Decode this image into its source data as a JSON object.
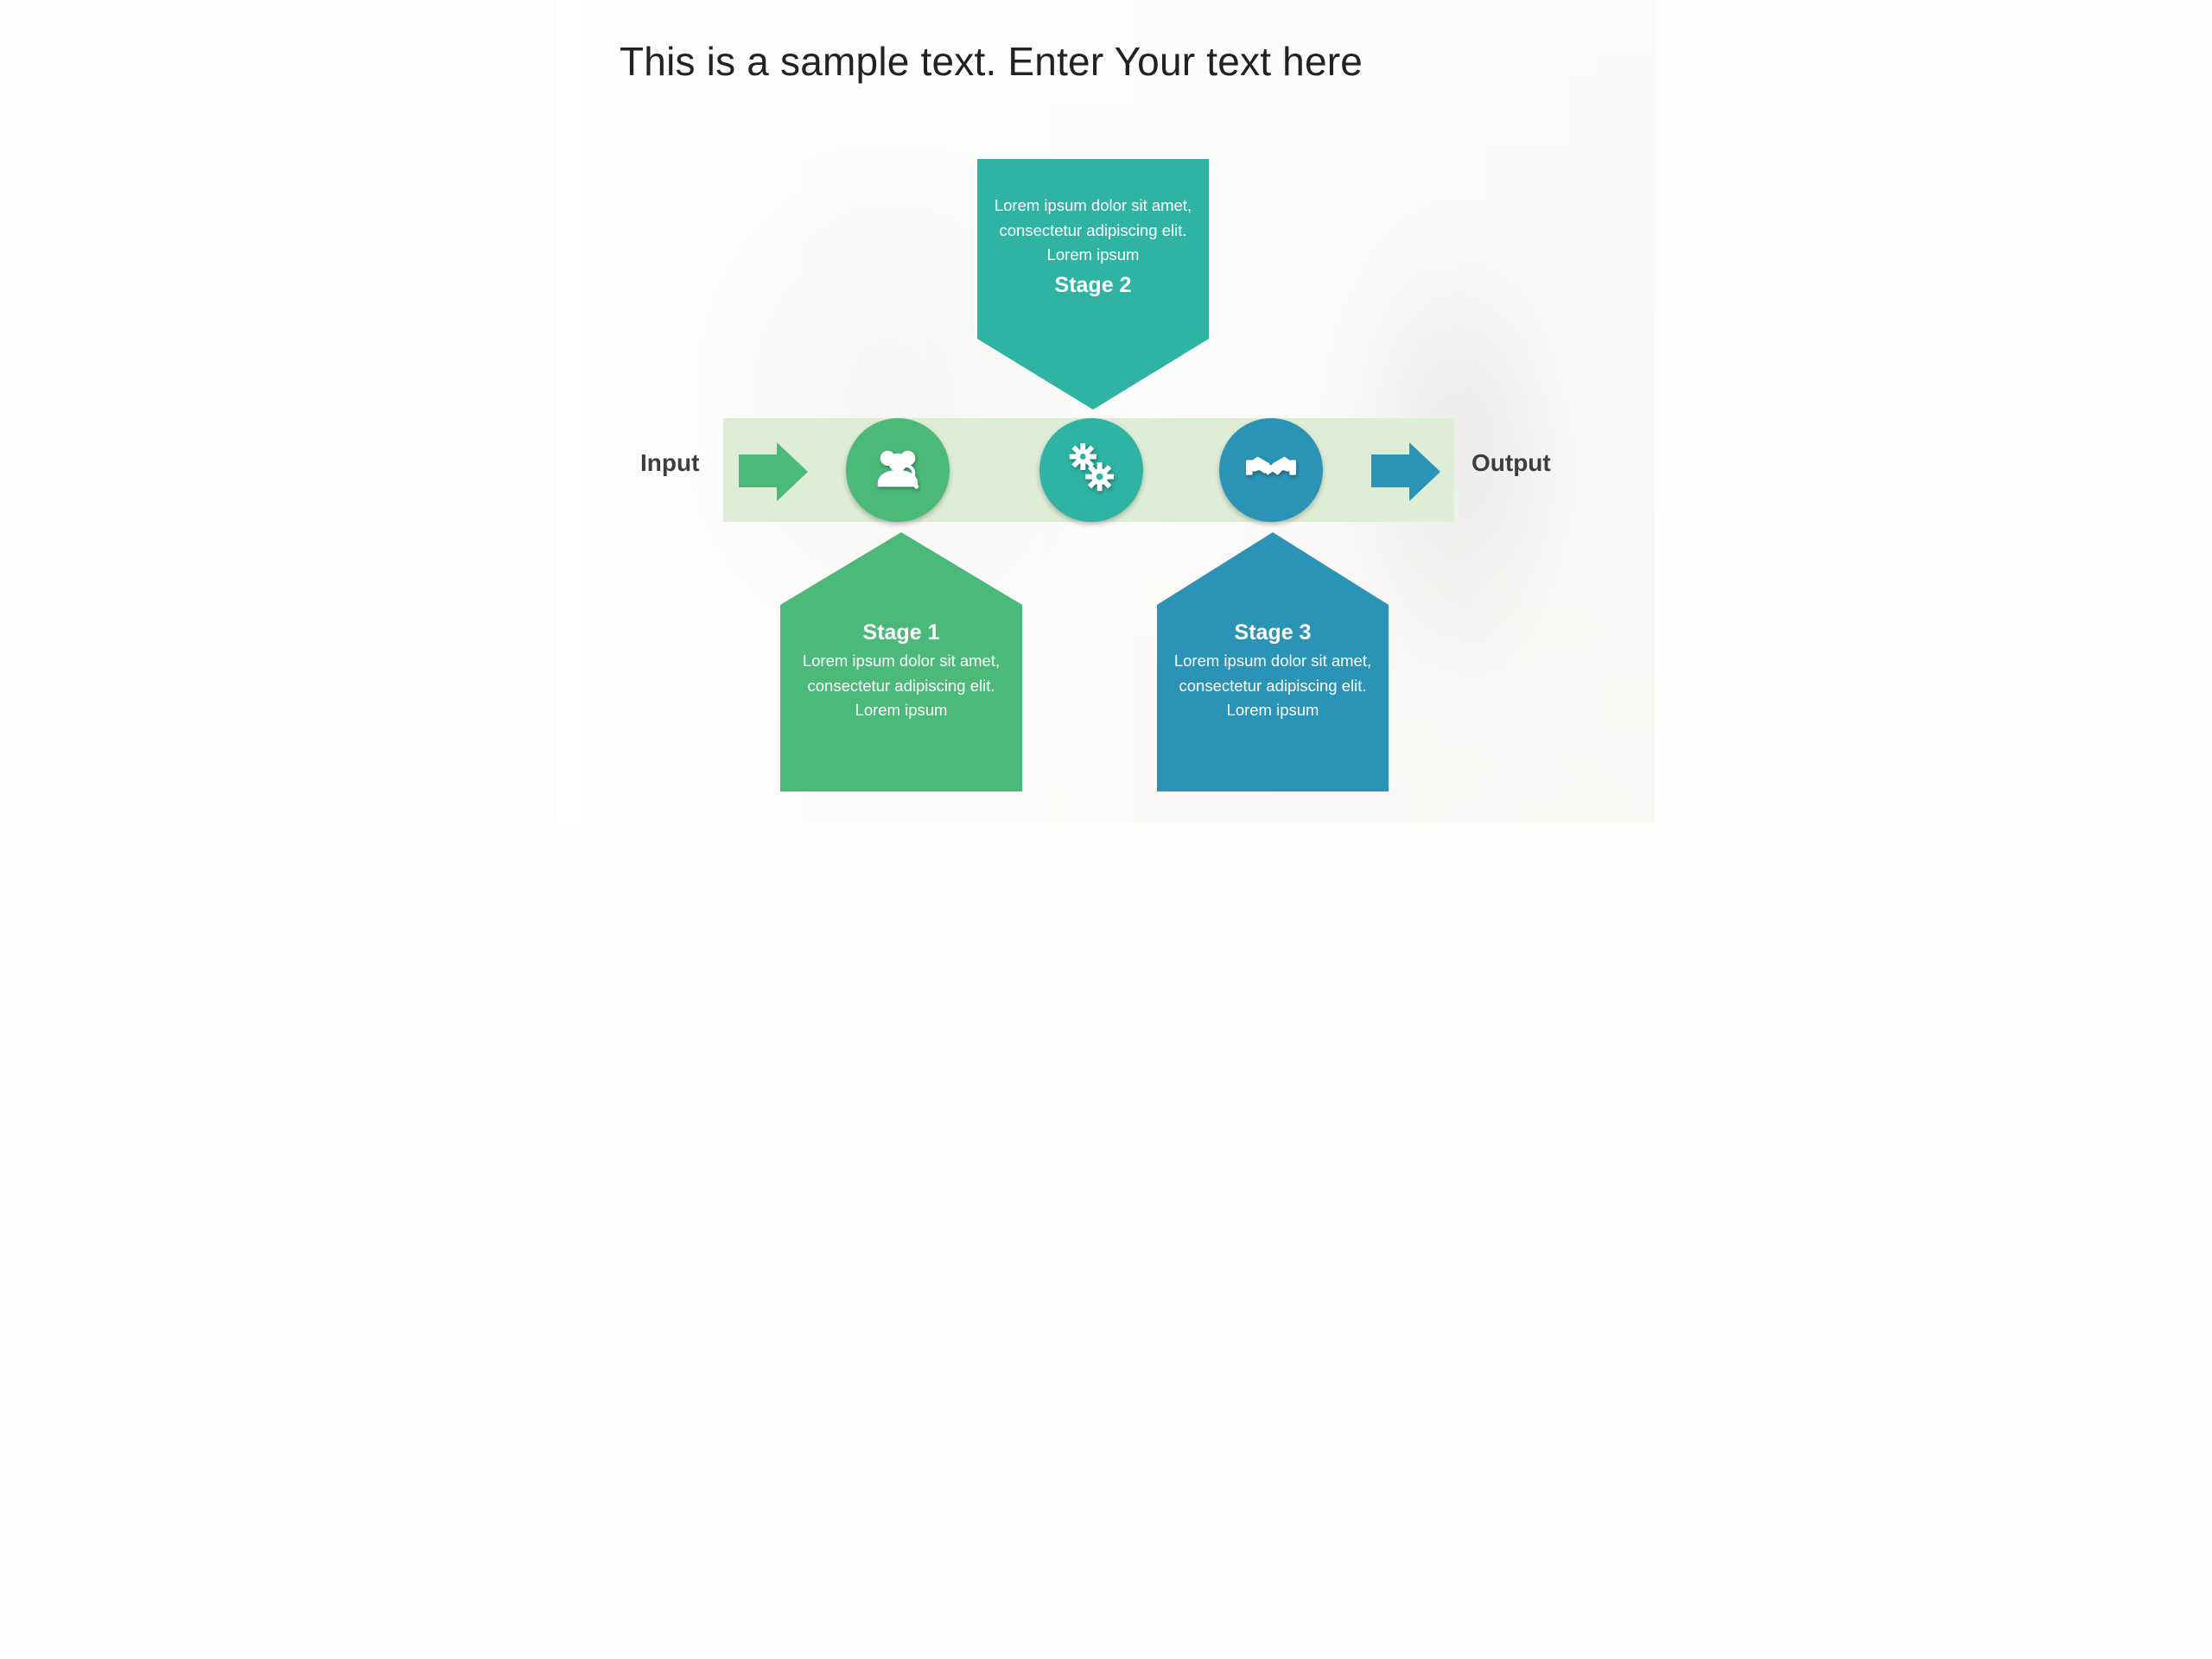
{
  "title": "This is a sample text. Enter Your text here",
  "labels": {
    "input": "Input",
    "output": "Output"
  },
  "colors": {
    "stage1": "#4bb97a",
    "stage2": "#2fb3a3",
    "stage3": "#2b93b6",
    "bar": "#deedd6"
  },
  "icons": {
    "stage1": "people-search-icon",
    "stage2": "gears-icon",
    "stage3": "handshake-icon"
  },
  "stages": [
    {
      "title": "Stage 1",
      "desc": "Lorem ipsum dolor sit amet, consectetur adipiscing elit. Lorem ipsum"
    },
    {
      "title": "Stage 2",
      "desc": "Lorem ipsum dolor sit amet, consectetur adipiscing elit. Lorem ipsum"
    },
    {
      "title": "Stage 3",
      "desc": "Lorem ipsum dolor sit amet, consectetur adipiscing elit. Lorem ipsum"
    }
  ]
}
